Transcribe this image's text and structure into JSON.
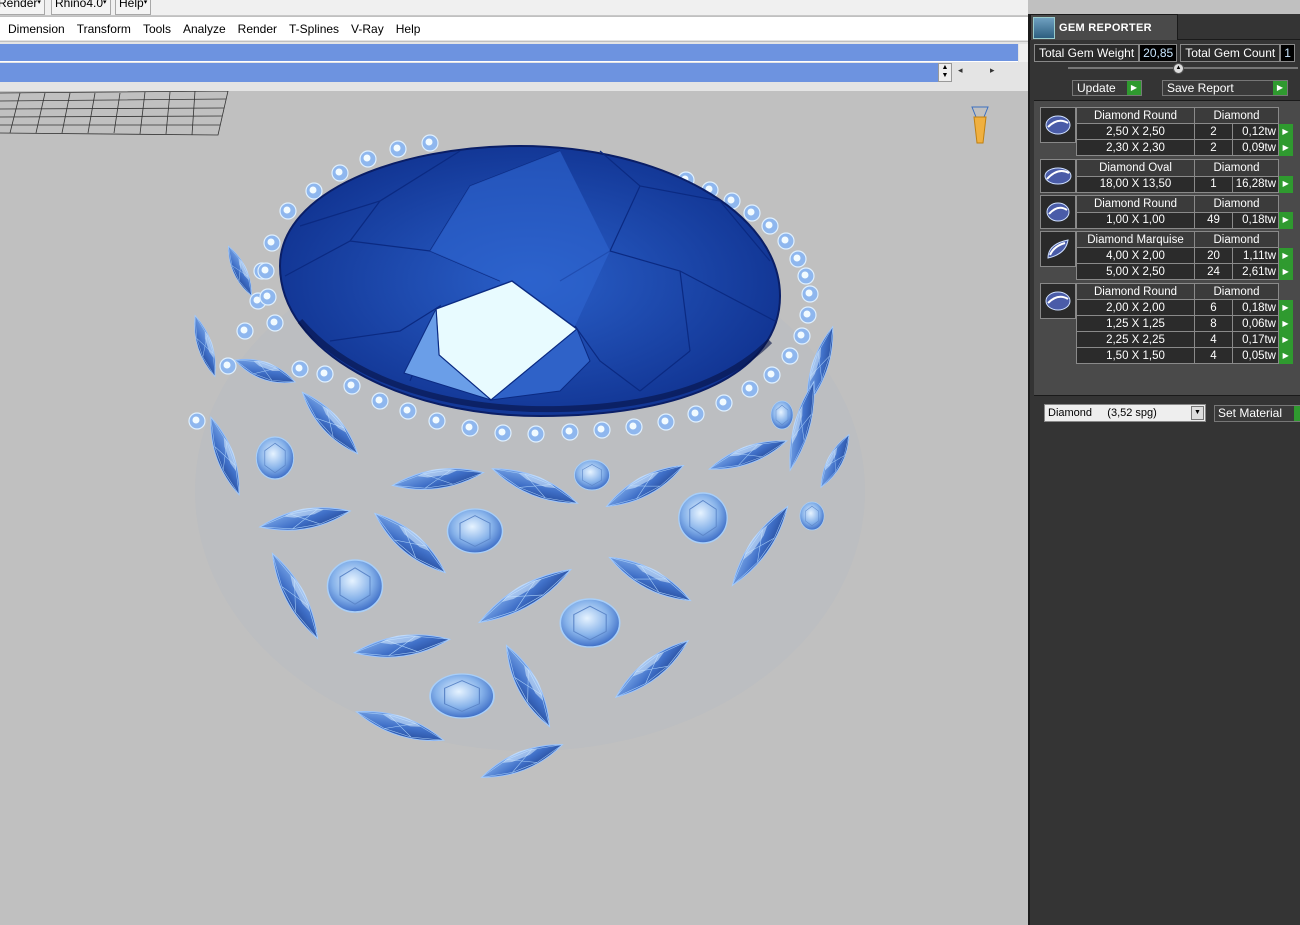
{
  "toolbar_strip": {
    "items": [
      {
        "label": "Render",
        "arrow": "▾"
      },
      {
        "label": "Rhino4.0",
        "arrow": "▾"
      },
      {
        "label": "Help",
        "arrow": "▾"
      }
    ]
  },
  "menu": {
    "items": [
      "Dimension",
      "Transform",
      "Tools",
      "Analyze",
      "Render",
      "T-Splines",
      "V-Ray",
      "Help"
    ]
  },
  "command": {
    "scroll_up": "▲",
    "scroll_down": "▼",
    "left": "◂",
    "right": "▸"
  },
  "panel": {
    "title": "GEM REPORTER",
    "total_weight_label": "Total Gem Weight",
    "total_weight_value": "20,85",
    "total_count_label": "Total Gem Count",
    "total_count_value": "1",
    "update_label": "Update",
    "save_label": "Save Report",
    "go_glyph": "▶",
    "groups": [
      {
        "shape": "round",
        "name": "Diamond Round",
        "material": "Diamond",
        "rows": [
          {
            "size": "2,50 X 2,50",
            "count": "2",
            "weight": "0,12tw"
          },
          {
            "size": "2,30 X 2,30",
            "count": "2",
            "weight": "0,09tw"
          }
        ]
      },
      {
        "shape": "oval",
        "name": "Diamond Oval",
        "material": "Diamond",
        "rows": [
          {
            "size": "18,00 X 13,50",
            "count": "1",
            "weight": "16,28tw"
          }
        ]
      },
      {
        "shape": "round",
        "name": "Diamond Round",
        "material": "Diamond",
        "rows": [
          {
            "size": "1,00 X 1,00",
            "count": "49",
            "weight": "0,18tw"
          }
        ]
      },
      {
        "shape": "marquise",
        "name": "Diamond Marquise",
        "material": "Diamond",
        "rows": [
          {
            "size": "4,00 X 2,00",
            "count": "20",
            "weight": "1,11tw"
          },
          {
            "size": "5,00 X 2,50",
            "count": "24",
            "weight": "2,61tw"
          }
        ]
      },
      {
        "shape": "round",
        "name": "Diamond Round",
        "material": "Diamond",
        "rows": [
          {
            "size": "2,00 X 2,00",
            "count": "6",
            "weight": "0,18tw"
          },
          {
            "size": "1,25 X 1,25",
            "count": "8",
            "weight": "0,06tw"
          },
          {
            "size": "2,25 X 2,25",
            "count": "4",
            "weight": "0,17tw"
          },
          {
            "size": "1,50 X 1,50",
            "count": "4",
            "weight": "0,05tw"
          }
        ]
      }
    ],
    "material_select_value": "Diamond     (3,52 spg)",
    "material_dropdown_glyph": "▼",
    "set_material_label": "Set Material"
  },
  "colors": {
    "viewport_bg": "#c0c0c0",
    "gem_blue": "#3f6fc7",
    "center_stone": "#1f4fb4",
    "panel_bg": "#343434",
    "go_green": "#2f9a2f",
    "command_blue": "#6d93e0"
  }
}
